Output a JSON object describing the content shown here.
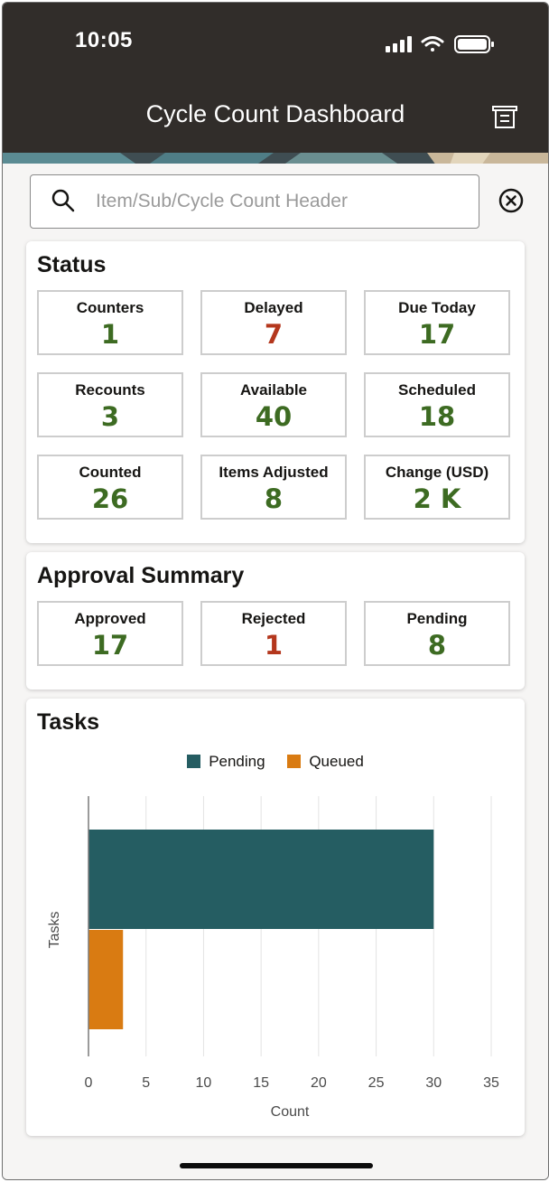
{
  "status_bar": {
    "time": "10:05"
  },
  "header": {
    "title": "Cycle Count Dashboard"
  },
  "search": {
    "placeholder": "Item/Sub/Cycle Count Header",
    "value": ""
  },
  "status": {
    "title": "Status",
    "tiles": [
      {
        "label": "Counters",
        "value": "1",
        "color": "#3d6b22"
      },
      {
        "label": "Delayed",
        "value": "7",
        "color": "#b4371d"
      },
      {
        "label": "Due Today",
        "value": "17",
        "color": "#3d6b22"
      },
      {
        "label": "Recounts",
        "value": "3",
        "color": "#3d6b22"
      },
      {
        "label": "Available",
        "value": "40",
        "color": "#3d6b22"
      },
      {
        "label": "Scheduled",
        "value": "18",
        "color": "#3d6b22"
      },
      {
        "label": "Counted",
        "value": "26",
        "color": "#3d6b22"
      },
      {
        "label": "Items Adjusted",
        "value": "8",
        "color": "#3d6b22"
      },
      {
        "label": "Change (USD)",
        "value": "2 K",
        "color": "#3d6b22"
      }
    ]
  },
  "approval": {
    "title": "Approval Summary",
    "tiles": [
      {
        "label": "Approved",
        "value": "17",
        "color": "#3d6b22"
      },
      {
        "label": "Rejected",
        "value": "1",
        "color": "#b4371d"
      },
      {
        "label": "Pending",
        "value": "8",
        "color": "#3d6b22"
      }
    ]
  },
  "tasks": {
    "title": "Tasks",
    "chart_data": {
      "type": "bar",
      "orientation": "horizontal",
      "categories": [
        "Tasks"
      ],
      "series": [
        {
          "name": "Pending",
          "values": [
            30
          ],
          "color": "#255d62"
        },
        {
          "name": "Queued",
          "values": [
            3
          ],
          "color": "#d97b12"
        }
      ],
      "xlabel": "Count",
      "ylabel": "Tasks",
      "xlim": [
        0,
        35
      ],
      "xticks": [
        "0",
        "5",
        "10",
        "15",
        "20",
        "25",
        "30",
        "35"
      ],
      "grid": true,
      "legend": "top-center"
    }
  }
}
